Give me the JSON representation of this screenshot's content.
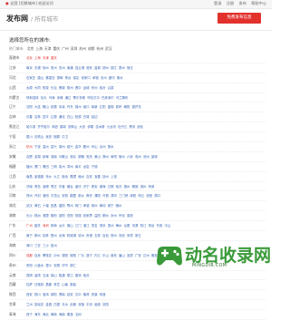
{
  "topbar": {
    "location_icon": "location-pin-icon",
    "location": "全国",
    "switch": "[切换城市]",
    "welcome": "欢迎访问",
    "login": "登录",
    "register": "注册",
    "post": "发布",
    "help": "帮助中心"
  },
  "header": {
    "brand": "发布网",
    "subtitle": "/ 所有城市",
    "post_button": "免费发布信息"
  },
  "main": {
    "title": "选择您所在的城市:",
    "hot_label": "热门城市:",
    "hot_cities": [
      "北京",
      "上海",
      "天津",
      "重庆",
      "广州",
      "深圳",
      "苏州",
      "成都",
      "杭州",
      "武汉"
    ],
    "provinces": [
      {
        "name": "直辖市",
        "cities": [
          "北京",
          "上海",
          "天津",
          "重庆"
        ]
      },
      {
        "name": "江苏",
        "cities": [
          "南京",
          "无锡",
          "徐州",
          "常州",
          "苏州",
          "南通",
          "连云港",
          "淮安",
          "盐城",
          "扬州",
          "镇江",
          "泰州",
          "宿迁"
        ]
      },
      {
        "name": "河北",
        "cities": [
          "石家庄",
          "唐山",
          "秦皇岛",
          "邯郸",
          "邢台",
          "保定",
          "张家口",
          "承德",
          "沧州",
          "廊坊",
          "衡水"
        ]
      },
      {
        "name": "山西",
        "cities": [
          "太原",
          "大同",
          "阳泉",
          "长治",
          "晋城",
          "朔州",
          "晋中",
          "运城",
          "忻州",
          "临汾",
          "吕梁"
        ]
      },
      {
        "name": "内蒙古",
        "cities": [
          "呼和浩特",
          "包头",
          "乌海",
          "赤峰",
          "通辽",
          "鄂尔多斯",
          "呼伦贝尔",
          "巴彦淖尔",
          "乌兰察布"
        ]
      },
      {
        "name": "辽宁",
        "cities": [
          "沈阳",
          "大连",
          "鞍山",
          "抚顺",
          "本溪",
          "丹东",
          "锦州",
          "营口",
          "阜新",
          "辽阳",
          "盘锦",
          "铁岭",
          "朝阳",
          "葫芦岛"
        ]
      },
      {
        "name": "吉林",
        "cities": [
          "长春",
          "吉林",
          "四平",
          "辽源",
          "通化",
          "白山",
          "松原",
          "白城",
          "延边"
        ]
      },
      {
        "name": "黑龙江",
        "cities": [
          "哈尔滨",
          "齐齐哈尔",
          "鸡西",
          "鹤岗",
          "双鸭山",
          "大庆",
          "伊春",
          "佳木斯",
          "七台河",
          "牡丹江",
          "黑河",
          "绥化"
        ]
      },
      {
        "name": "宁夏",
        "cities": [
          "银川",
          "石嘴山",
          "吴忠",
          "固原",
          "中卫"
        ]
      },
      {
        "name": "浙江",
        "cities": [
          "杭州",
          "宁波",
          "温州",
          "嘉兴",
          "湖州",
          "绍兴",
          "金华",
          "衢州",
          "舟山",
          "台州",
          "丽水"
        ]
      },
      {
        "name": "安徽",
        "cities": [
          "合肥",
          "芜湖",
          "蚌埠",
          "淮南",
          "马鞍山",
          "淮北",
          "铜陵",
          "安庆",
          "黄山",
          "滁州",
          "阜阳",
          "宿州",
          "六安",
          "亳州",
          "池州",
          "宣城"
        ]
      },
      {
        "name": "福建",
        "cities": [
          "福州",
          "厦门",
          "莆田",
          "三明",
          "泉州",
          "漳州",
          "南平",
          "龙岩",
          "宁德"
        ]
      },
      {
        "name": "江西",
        "cities": [
          "南昌",
          "景德镇",
          "萍乡",
          "九江",
          "新余",
          "鹰潭",
          "赣州",
          "吉安",
          "宜春",
          "抚州",
          "上饶"
        ]
      },
      {
        "name": "山东",
        "cities": [
          "济南",
          "青岛",
          "淄博",
          "枣庄",
          "东营",
          "烟台",
          "潍坊",
          "济宁",
          "泰安",
          "威海",
          "日照",
          "临沂",
          "德州",
          "聊城",
          "滨州",
          "菏泽"
        ]
      },
      {
        "name": "河南",
        "cities": [
          "郑州",
          "开封",
          "洛阳",
          "平顶山",
          "安阳",
          "鹤壁",
          "新乡",
          "焦作",
          "濮阳",
          "许昌",
          "漯河",
          "三门峡",
          "南阳",
          "商丘",
          "信阳",
          "周口"
        ]
      },
      {
        "name": "湖北",
        "cities": [
          "武汉",
          "黄石",
          "十堰",
          "宜昌",
          "襄阳",
          "鄂州",
          "荆门",
          "孝感",
          "荆州",
          "黄冈",
          "咸宁",
          "随州"
        ]
      },
      {
        "name": "湖南",
        "cities": [
          "长沙",
          "株洲",
          "湘潭",
          "衡阳",
          "邵阳",
          "岳阳",
          "常德",
          "张家界",
          "益阳",
          "郴州",
          "永州",
          "怀化",
          "娄底"
        ]
      },
      {
        "name": "广东",
        "cities": [
          "广州",
          "韶关",
          "深圳",
          "珠海",
          "汕头",
          "佛山",
          "江门",
          "湛江",
          "茂名",
          "肇庆",
          "惠州",
          "梅州",
          "汕尾",
          "河源",
          "阳江",
          "清远",
          "东莞",
          "中山"
        ]
      },
      {
        "name": "广西",
        "cities": [
          "南宁",
          "柳州",
          "桂林",
          "梧州",
          "北海",
          "防城港",
          "钦州",
          "贵港",
          "玉林",
          "百色",
          "贺州",
          "河池",
          "来宾",
          "崇左"
        ]
      },
      {
        "name": "海南",
        "cities": [
          "海口",
          "三亚",
          "三沙",
          "儋州"
        ]
      },
      {
        "name": "四川",
        "cities": [
          "成都",
          "自贡",
          "攀枝花",
          "泸州",
          "德阳",
          "绵阳",
          "广元",
          "遂宁",
          "内江",
          "乐山",
          "南充",
          "眉山",
          "宜宾",
          "广安",
          "达州",
          "雅安"
        ]
      },
      {
        "name": "贵州",
        "cities": [
          "贵阳",
          "六盘水",
          "遵义",
          "安顺",
          "毕节",
          "铜仁"
        ]
      },
      {
        "name": "云南",
        "cities": [
          "昆明",
          "曲靖",
          "玉溪",
          "保山",
          "昭通",
          "丽江",
          "普洱",
          "临沧"
        ]
      },
      {
        "name": "西藏",
        "cities": [
          "拉萨",
          "日喀则",
          "昌都",
          "林芝",
          "山南",
          "那曲"
        ]
      },
      {
        "name": "陕西",
        "cities": [
          "西安",
          "铜川",
          "宝鸡",
          "咸阳",
          "渭南",
          "延安",
          "汉中",
          "榆林",
          "安康",
          "商洛"
        ]
      },
      {
        "name": "甘肃",
        "cities": [
          "兰州",
          "嘉峪关",
          "金昌",
          "白银",
          "天水",
          "武威",
          "张掖",
          "平凉",
          "酒泉",
          "庆阳"
        ]
      },
      {
        "name": "青海",
        "cities": [
          "西宁",
          "海东",
          "海北",
          "黄南",
          "海南",
          "果洛",
          "玉树"
        ]
      }
    ]
  },
  "watermark": {
    "logo_icon": "game-controller-icon",
    "text": "动名收录网",
    "url": "MINGDIR.COM"
  },
  "colors": {
    "accent": "#e2312d",
    "link": "#3a67b8",
    "watermark": "#3a9a3a"
  }
}
